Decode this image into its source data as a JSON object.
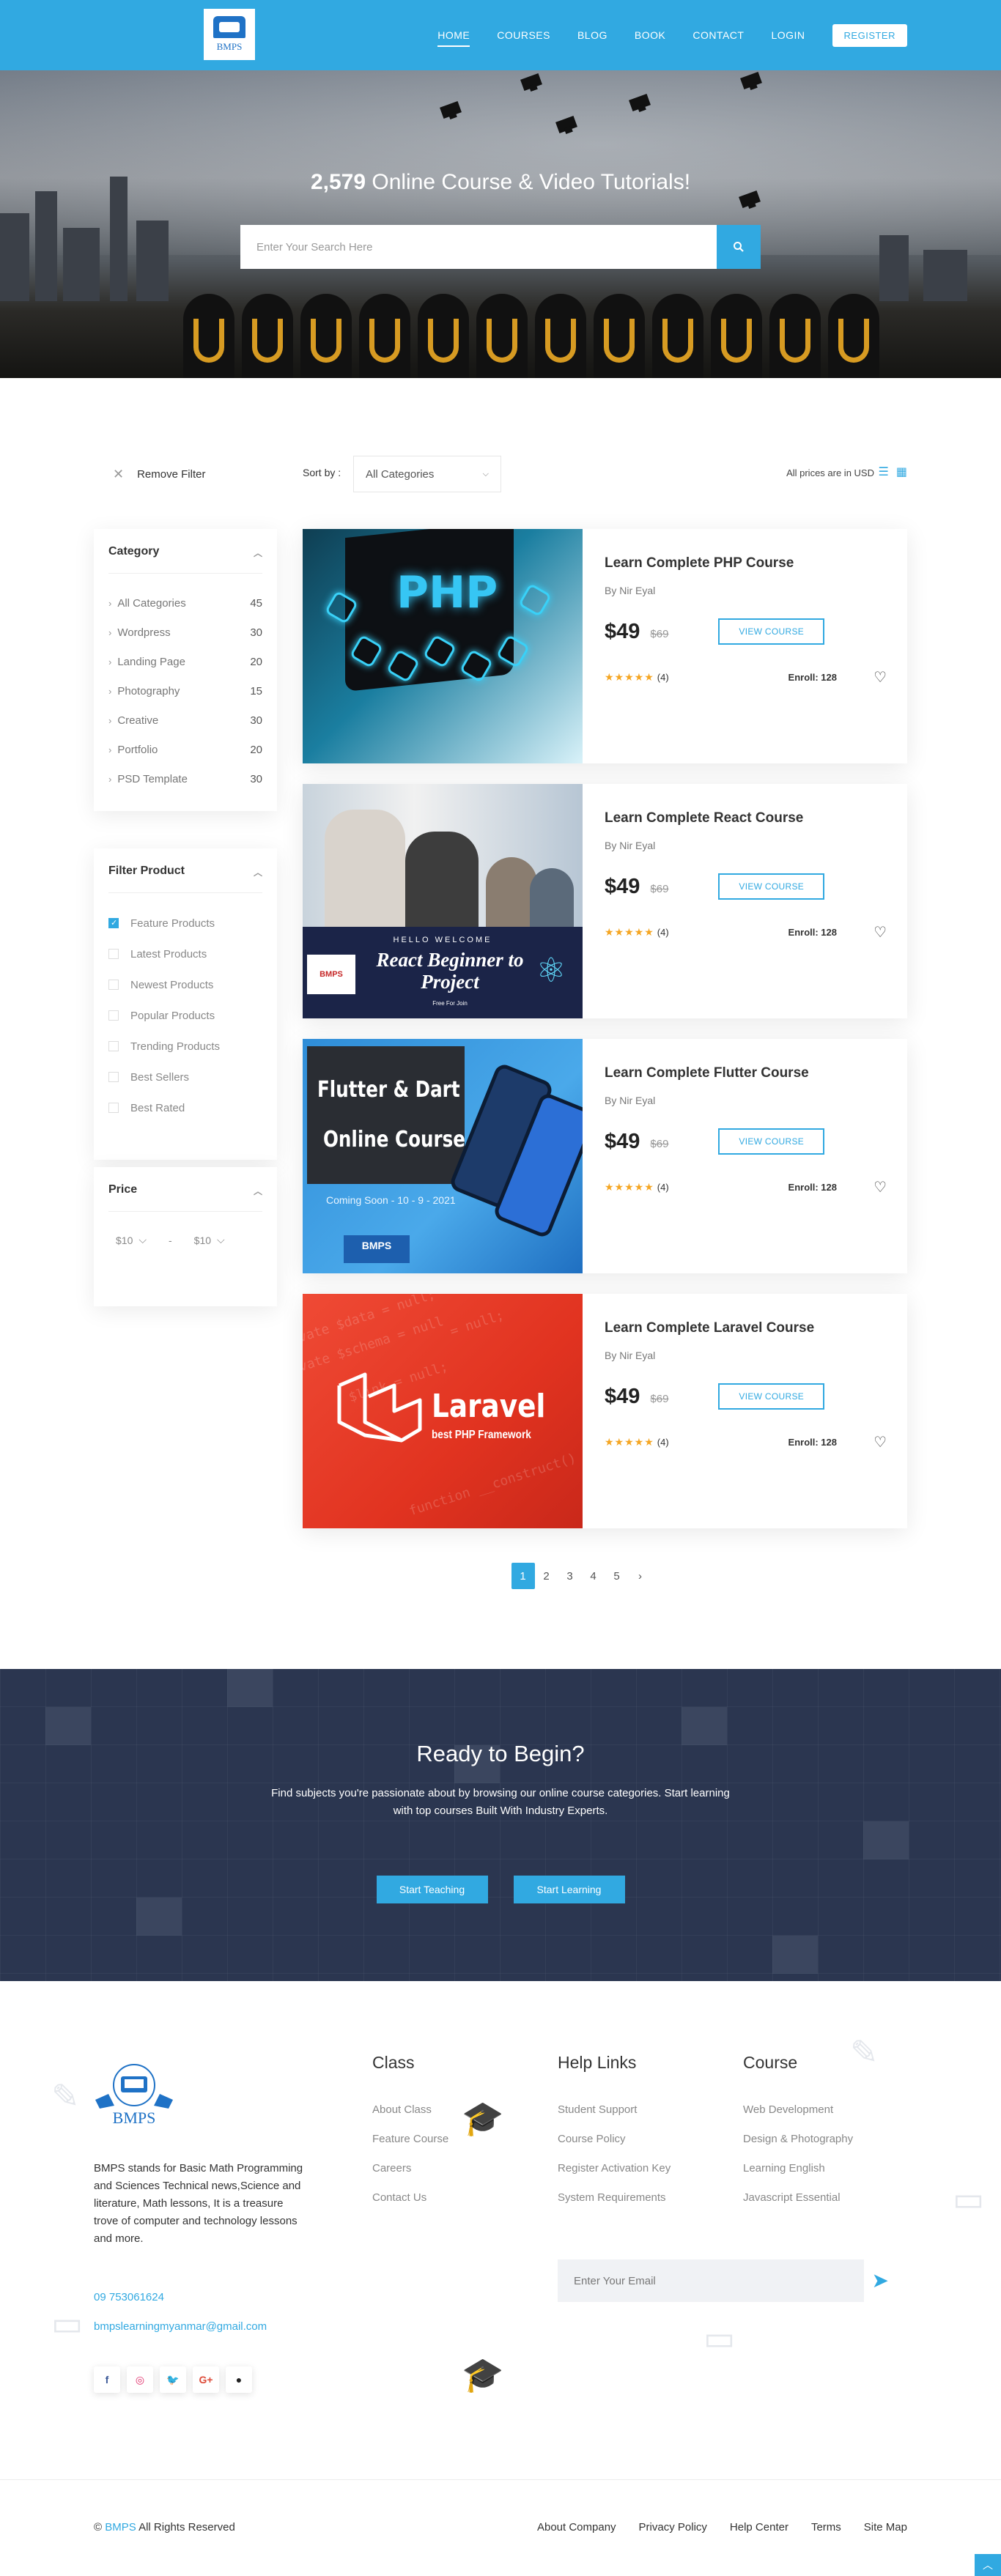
{
  "header": {
    "logo_text": "BMPS",
    "nav": [
      {
        "label": "HOME",
        "active": true
      },
      {
        "label": "COURSES"
      },
      {
        "label": "BLOG"
      },
      {
        "label": "BOOK"
      },
      {
        "label": "CONTACT"
      },
      {
        "label": "LOGIN"
      }
    ],
    "register_label": "REGISTER",
    "accent_color": "#31a9e1"
  },
  "hero": {
    "count": "2,579",
    "title_rest": "Online Course & Video Tutorials!",
    "search_placeholder": "Enter Your Search Here",
    "search_icon": "search-icon"
  },
  "toolbar": {
    "remove_filter": "Remove Filter",
    "sort_by": "Sort by :",
    "sort_value": "All Categories",
    "prices_note": "All prices are in USD"
  },
  "sidebar": {
    "category": {
      "title": "Category",
      "items": [
        {
          "label": "All Categories",
          "count": "45"
        },
        {
          "label": "Wordpress",
          "count": "30"
        },
        {
          "label": "Landing Page",
          "count": "20"
        },
        {
          "label": "Photography",
          "count": "15"
        },
        {
          "label": "Creative",
          "count": "30"
        },
        {
          "label": "Portfolio",
          "count": "20"
        },
        {
          "label": "PSD Template",
          "count": "30"
        }
      ]
    },
    "filter_product": {
      "title": "Filter Product",
      "items": [
        {
          "label": "Feature Products",
          "checked": true
        },
        {
          "label": "Latest Products",
          "checked": false
        },
        {
          "label": "Newest Products",
          "checked": false
        },
        {
          "label": "Popular Products",
          "checked": false
        },
        {
          "label": "Trending Products",
          "checked": false
        },
        {
          "label": "Best Sellers",
          "checked": false
        },
        {
          "label": "Best Rated",
          "checked": false
        }
      ]
    },
    "price": {
      "title": "Price",
      "min": "$10",
      "separator": "-",
      "max": "$10"
    }
  },
  "courses": [
    {
      "title": "Learn Complete PHP Course",
      "author": "By Nir Eyal",
      "price": "$49",
      "old_price": "$69",
      "button": "VIEW COURSE",
      "stars": 5,
      "reviews": "(4)",
      "enroll": "Enroll: 128",
      "thumb_text": "PHP"
    },
    {
      "title": "Learn Complete React Course",
      "author": "By Nir Eyal",
      "price": "$49",
      "old_price": "$69",
      "button": "VIEW COURSE",
      "stars": 5,
      "reviews": "(4)",
      "enroll": "Enroll: 128",
      "thumb_welcome": "HELLO WELCOME",
      "thumb_text": "React Beginner to Project",
      "thumb_free": "Free For Join"
    },
    {
      "title": "Learn Complete Flutter Course",
      "author": "By Nir Eyal",
      "price": "$49",
      "old_price": "$69",
      "button": "VIEW COURSE",
      "stars": 5,
      "reviews": "(4)",
      "enroll": "Enroll: 128",
      "thumb_line1": "Flutter & Dart",
      "thumb_line2": "Online Course",
      "thumb_soon": "Coming Soon - 10 - 9 - 2021",
      "thumb_badge": "BMPS"
    },
    {
      "title": "Learn Complete Laravel Course",
      "author": "By Nir Eyal",
      "price": "$49",
      "old_price": "$69",
      "button": "VIEW COURSE",
      "stars": 5,
      "reviews": "(4)",
      "enroll": "Enroll: 128",
      "thumb_text": "Laravel",
      "thumb_sub": "best PHP Framework"
    }
  ],
  "pagination": {
    "pages": [
      "1",
      "2",
      "3",
      "4",
      "5"
    ],
    "current": "1",
    "next_icon": "chevron-right-icon"
  },
  "cta": {
    "title": "Ready to Begin?",
    "text": "Find subjects you're passionate about by browsing our online course categories. Start learning with top courses Built With Industry Experts.",
    "btn_teach": "Start Teaching",
    "btn_learn": "Start Learning"
  },
  "footer": {
    "about": "BMPS stands for Basic Math Programming and Sciences Technical news,Science and literature, Math lessons, It is a treasure trove of computer and technology lessons and more.",
    "phone": "09 753061624",
    "email": "bmpslearningmyanmar@gmail.com",
    "socials": [
      "facebook-icon",
      "instagram-icon",
      "twitter-icon",
      "google-plus-icon",
      "github-icon"
    ],
    "columns": [
      {
        "title": "Class",
        "links": [
          "About Class",
          "Feature Course",
          "Careers",
          "Contact Us"
        ]
      },
      {
        "title": "Help Links",
        "links": [
          "Student Support",
          "Course Policy",
          "Register Activation Key",
          "System Requirements"
        ]
      },
      {
        "title": "Course",
        "links": [
          "Web Development",
          "Design & Photography",
          "Learning English",
          "Javascript Essential"
        ]
      }
    ],
    "email_placeholder": "Enter Your Email",
    "copyright_symbol": "©",
    "copyright_brand": "BMPS",
    "copyright_rest": "All Rights Reserved",
    "bottom_links": [
      "About Company",
      "Privacy Policy",
      "Help Center",
      "Terms",
      "Site Map"
    ]
  }
}
